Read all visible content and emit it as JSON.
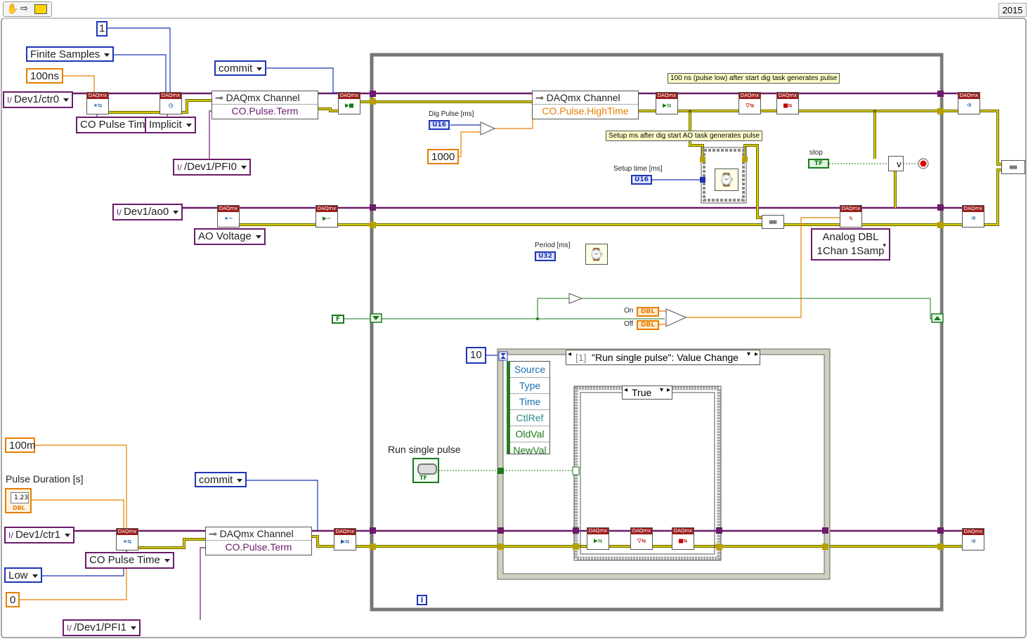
{
  "toolbar": {
    "version": "2015"
  },
  "colors": {
    "purple_wire": "#6a1b6a",
    "error_wire": "#b8a000",
    "blue": "#1e35b5",
    "orange": "#e67e00",
    "green": "#1b7a1b",
    "daqmx_header": "#9b1c1c"
  },
  "counter1": {
    "samples_value": "1",
    "sample_mode": "Finite Samples",
    "initial_delay": "100ns",
    "channel": "Dev1/ctr0",
    "channel_type": "CO Pulse Time",
    "timing": "Implicit",
    "property_node_title": "DAQmx Channel",
    "property_name": "CO.Pulse.Term",
    "terminal": "/Dev1/PFI0",
    "commit": "commit"
  },
  "analog": {
    "channel": "Dev1/ao0",
    "channel_type": "AO Voltage",
    "write_type_line1": "Analog DBL",
    "write_type_line2": "1Chan 1Samp"
  },
  "loop": {
    "note_pulse": "100 ns (pulse low) after start dig task generates pulse",
    "note_setup": "Setup ms after dig start AO task generates pulse",
    "property_node_title": "DAQmx Channel",
    "property_name": "CO.Pulse.HighTime",
    "dig_pulse_label": "Dig Pulse [ms]",
    "dig_pulse_type": "U16",
    "constant_1000": "1000",
    "setup_time_label": "Setup time [ms]",
    "setup_time_type": "U16",
    "period_label": "Period [ms]",
    "period_type": "U32",
    "stop_label": "stop",
    "stop_type": "TF",
    "on_label": "On",
    "off_label": "Off",
    "dbl_type": "DBL",
    "false_const": "F",
    "iteration": "i"
  },
  "event": {
    "timeout": "10",
    "case_index": "[1]",
    "case_name": "\"Run single pulse\": Value Change",
    "data_items": [
      "Source",
      "Type",
      "Time",
      "CtlRef",
      "OldVal",
      "NewVal"
    ],
    "inner_case": "True",
    "button_label": "Run single pulse",
    "button_type": "TF"
  },
  "counter2": {
    "delay_value": "100m",
    "pulse_duration_label": "Pulse Duration [s]",
    "pulse_duration_value": "1.23",
    "pulse_duration_type": "DBL",
    "channel": "Dev1/ctr1",
    "channel_type": "CO Pulse Time",
    "idle_state": "Low",
    "zero_value": "0",
    "property_node_title": "DAQmx Channel",
    "property_name": "CO.Pulse.Term",
    "terminal": "/Dev1/PFI1",
    "commit": "commit"
  },
  "daqmx_header": "DAQmx"
}
